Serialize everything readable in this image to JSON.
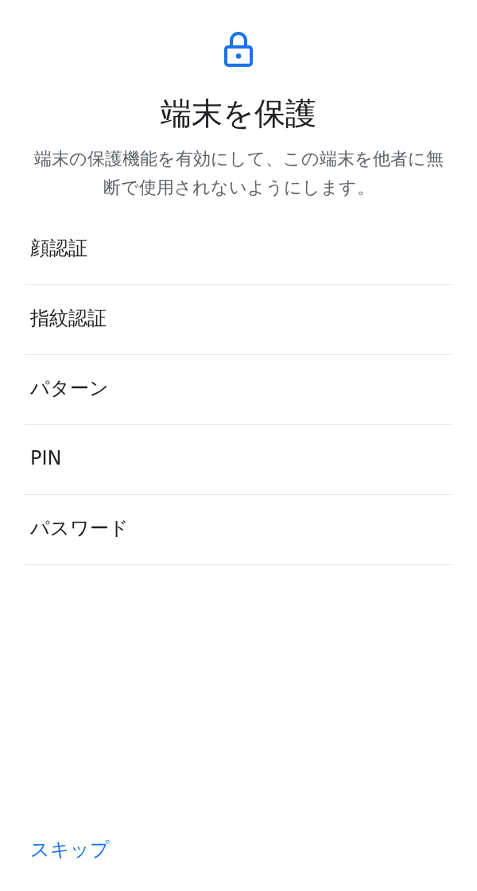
{
  "header": {
    "title": "端末を保護",
    "description": "端末の保護機能を有効にして、この端末を他者に無断で使用されないようにします。"
  },
  "options": [
    {
      "label": "顔認証"
    },
    {
      "label": "指紋認証"
    },
    {
      "label": "パターン"
    },
    {
      "label": "PIN"
    },
    {
      "label": "パスワード"
    }
  ],
  "skip_link": {
    "label": "スキップ"
  }
}
